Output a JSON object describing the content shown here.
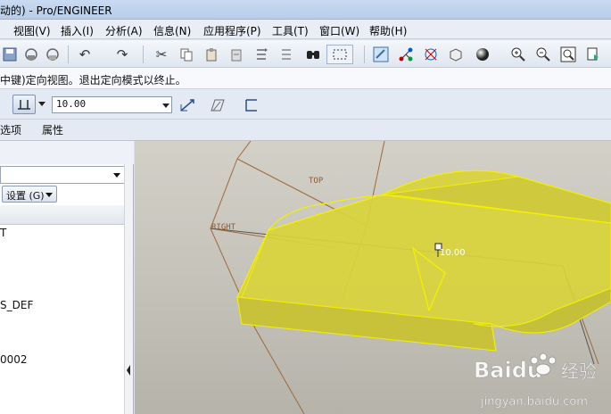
{
  "window": {
    "title": "动的) - Pro/ENGINEER"
  },
  "menu": [
    "视图(V)",
    "插入(I)",
    "分析(A)",
    "信息(N)",
    "应用程序(P)",
    "工具(T)",
    "窗口(W)",
    "帮助(H)"
  ],
  "toolbar": {
    "icons": [
      "save-icon",
      "save-copy-icon",
      "backup-icon",
      "undo-icon",
      "redo-icon",
      "cut-icon",
      "copy-icon",
      "paste-icon",
      "paste-special-icon",
      "regenerate-icon",
      "regenerate-manager-icon",
      "find-icon",
      "select-box-icon",
      "repaint-icon",
      "spin-center-icon",
      "orient-mode-icon",
      "saved-views-icon",
      "shading-icon",
      "zoom-in-icon",
      "zoom-out-icon",
      "refit-icon",
      "view-manager-icon"
    ]
  },
  "message": {
    "text": "中键)定向视图。退出定向模式以终止。"
  },
  "dashboard": {
    "depth_value": "10.00",
    "tabs": {
      "options": "选项",
      "properties": "属性"
    }
  },
  "model_tree": {
    "settings_label": "设置 (G)",
    "items": [
      "T",
      "S_DEF",
      "0002"
    ]
  },
  "viewport": {
    "datum_labels": {
      "top": "TOP",
      "right": "RIGHT"
    },
    "dimension": "10.00",
    "colors": {
      "model_fill": "#d9d43b",
      "model_edge": "#f4f000",
      "datum": "#a0683a"
    }
  },
  "watermark": {
    "brand": "Baidu",
    "brand_cn": "经验",
    "url": "jingyan.baidu.com"
  }
}
